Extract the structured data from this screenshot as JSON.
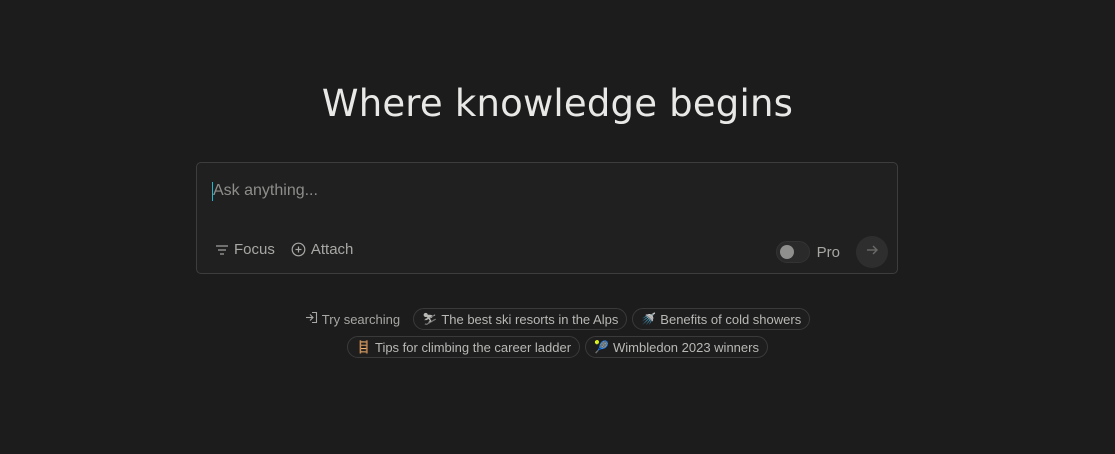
{
  "headline": "Where knowledge begins",
  "search": {
    "placeholder": "Ask anything...",
    "focus_label": "Focus",
    "attach_label": "Attach",
    "pro_label": "Pro"
  },
  "suggestions": {
    "try_label": "Try searching",
    "row1": [
      {
        "emoji": "⛷",
        "label": "The best ski resorts in the Alps"
      },
      {
        "emoji": "🚿",
        "label": "Benefits of cold showers"
      }
    ],
    "row2": [
      {
        "emoji": "🪜",
        "label": "Tips for climbing the career ladder"
      },
      {
        "emoji": "🎾",
        "label": "Wimbledon 2023 winners"
      }
    ]
  },
  "colors": {
    "background": "#1c1c1c",
    "accent": "#20b8cd",
    "border": "#3d3d3d"
  }
}
